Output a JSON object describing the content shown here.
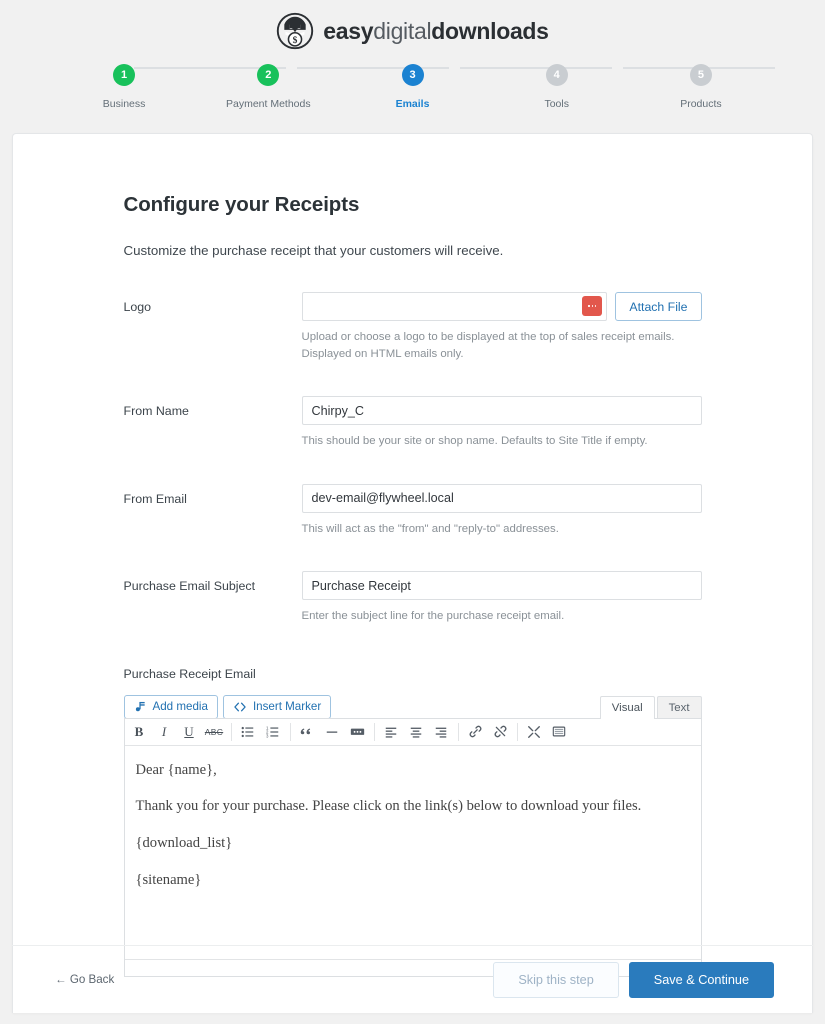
{
  "brand": {
    "logo_icon": "edd-download-dollar-icon",
    "text_part1": "easy",
    "text_part2": "digital",
    "text_part3": "downloads"
  },
  "steps": [
    {
      "number": "1",
      "label": "Business",
      "state": "done"
    },
    {
      "number": "2",
      "label": "Payment Methods",
      "state": "done"
    },
    {
      "number": "3",
      "label": "Emails",
      "state": "current"
    },
    {
      "number": "4",
      "label": "Tools",
      "state": "todo"
    },
    {
      "number": "5",
      "label": "Products",
      "state": "todo"
    }
  ],
  "colors": {
    "step_done": "#18c15b",
    "step_current": "#1b82d1",
    "step_todo": "#c9cdd1",
    "primary": "#2a7bbd",
    "link": "#2271b1",
    "danger": "#e2574c"
  },
  "main": {
    "title": "Configure your Receipts",
    "subtitle": "Customize the purchase receipt that your customers will receive."
  },
  "fields": {
    "logo": {
      "label": "Logo",
      "value": "",
      "placeholder": "",
      "picker_icon": "ellipsis-icon",
      "attach_label": "Attach File",
      "help": "Upload or choose a logo to be displayed at the top of sales receipt emails. Displayed on HTML emails only."
    },
    "from_name": {
      "label": "From Name",
      "value": "Chirpy_C",
      "help": "This should be your site or shop name. Defaults to Site Title if empty."
    },
    "from_email": {
      "label": "From Email",
      "value": "dev-email@flywheel.local",
      "help": "This will act as the \"from\" and \"reply-to\" addresses."
    },
    "subject": {
      "label": "Purchase Email Subject",
      "value": "Purchase Receipt",
      "help": "Enter the subject line for the purchase receipt email."
    }
  },
  "editor": {
    "label": "Purchase Receipt Email",
    "add_media_label": "Add media",
    "insert_marker_label": "Insert Marker",
    "tabs": [
      {
        "label": "Visual",
        "active": true
      },
      {
        "label": "Text",
        "active": false
      }
    ],
    "toolbar": [
      {
        "name": "bold-icon",
        "glyph": "B"
      },
      {
        "name": "italic-icon",
        "glyph": "I"
      },
      {
        "name": "underline-icon",
        "glyph": "U"
      },
      {
        "name": "strikethrough-icon",
        "glyph": "ABC"
      },
      {
        "name": "bulleted-list-icon"
      },
      {
        "name": "numbered-list-icon"
      },
      {
        "name": "blockquote-icon"
      },
      {
        "name": "horizontal-rule-icon"
      },
      {
        "name": "read-more-icon"
      },
      {
        "name": "align-left-icon"
      },
      {
        "name": "align-center-icon"
      },
      {
        "name": "align-right-icon"
      },
      {
        "name": "insert-link-icon"
      },
      {
        "name": "remove-link-icon"
      },
      {
        "name": "fullscreen-icon"
      },
      {
        "name": "toolbar-toggle-icon"
      }
    ],
    "content": [
      "Dear {name},",
      "Thank you for your purchase. Please click on the link(s) below to download your files.",
      "{download_list}",
      "{sitename}"
    ]
  },
  "footer": {
    "go_back": "← Go Back",
    "skip_label": "Skip this step",
    "save_label": "Save & Continue"
  }
}
